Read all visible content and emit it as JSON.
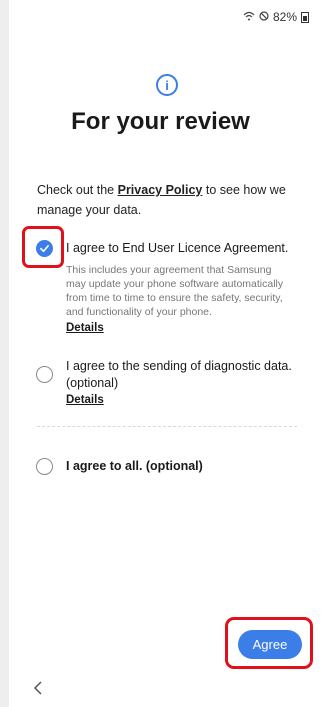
{
  "status_bar": {
    "battery": "82%"
  },
  "header": {
    "title": "For your review"
  },
  "intro": {
    "prefix": "Check out the ",
    "link": "Privacy Policy",
    "suffix": " to see how we manage your data."
  },
  "options": [
    {
      "label": "I agree to End User Licence Agreement.",
      "description": "This includes your agreement that Samsung may update your phone software automatically from time to time to ensure the safety, security, and functionality of your phone.",
      "details": "Details",
      "checked": true
    },
    {
      "label": "I agree to the sending of diagnostic data. (optional)",
      "details": "Details",
      "checked": false
    },
    {
      "label": "I agree to all. (optional)",
      "checked": false
    }
  ],
  "footer": {
    "agree_label": "Agree"
  },
  "colors": {
    "accent": "#3b7ee8",
    "highlight": "#e0111b"
  },
  "icons": [
    "wifi-icon",
    "do-not-disturb-icon",
    "battery-icon",
    "info-icon",
    "check-icon",
    "back-icon"
  ]
}
